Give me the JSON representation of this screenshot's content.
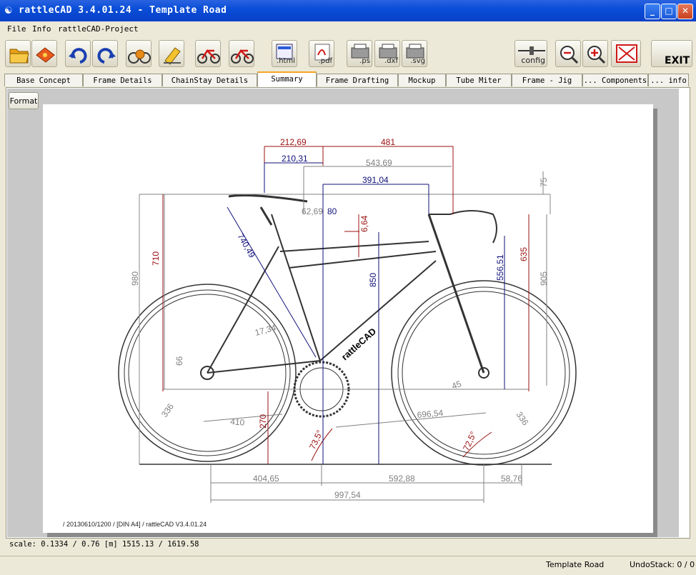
{
  "window": {
    "title": "rattleCAD  3.4.01.24 - Template Road"
  },
  "menu": {
    "file": "File",
    "info": "Info",
    "project": "rattleCAD-Project"
  },
  "toolbar": {
    "html": ".html",
    "pdf": ".pdf",
    "ps": ".ps",
    "dxf": ".dxf",
    "svg": ".svg",
    "config": "config",
    "exit": "EXIT"
  },
  "tabs": [
    "Base Concept",
    "Frame Details",
    "ChainStay Details",
    "Summary",
    "Frame Drafting",
    "Mockup",
    "Tube Miter",
    "Frame - Jig",
    "... Components",
    "... info"
  ],
  "format_button": "Format",
  "drawing": {
    "dims": {
      "d212_69": "212,69",
      "d481": "481",
      "d210_31": "210,31",
      "d543_69": "543,69",
      "d391_04": "391,04",
      "d75": "75",
      "d62_69": "62,69",
      "d80": "80",
      "d6_64": "6,64",
      "d710": "710",
      "d980": "980",
      "d740_49": "740,49",
      "d850": "850",
      "d556_51": "556,51",
      "d635": "635",
      "d905": "905",
      "d66": "66",
      "d17_34": "17,34",
      "d45": "45",
      "d336a": "336",
      "d336b": "336",
      "d410": "410",
      "d270": "270",
      "d73_5": "73,5°",
      "d72_5": "72,5°",
      "d696_54": "696,54",
      "d404_65": "404,65",
      "d592_88": "592,88",
      "d58_76": "58,76",
      "d997_54": "997,54"
    },
    "frame_text": "rattleCAD",
    "footer": "/  20130610/1200  /  [DIN A4]  /  rattleCAD  V3.4.01.24"
  },
  "scale_text": "scale: 0.1334 / 0.76  [m]  1515.13 / 1619.58",
  "status": {
    "name": "Template Road",
    "undo": "UndoStack:  0 / 0"
  },
  "colors": {
    "dim_red": "#9b1010",
    "dim_blue": "#10107a",
    "dim_gray": "#808080",
    "line": "#333333"
  }
}
